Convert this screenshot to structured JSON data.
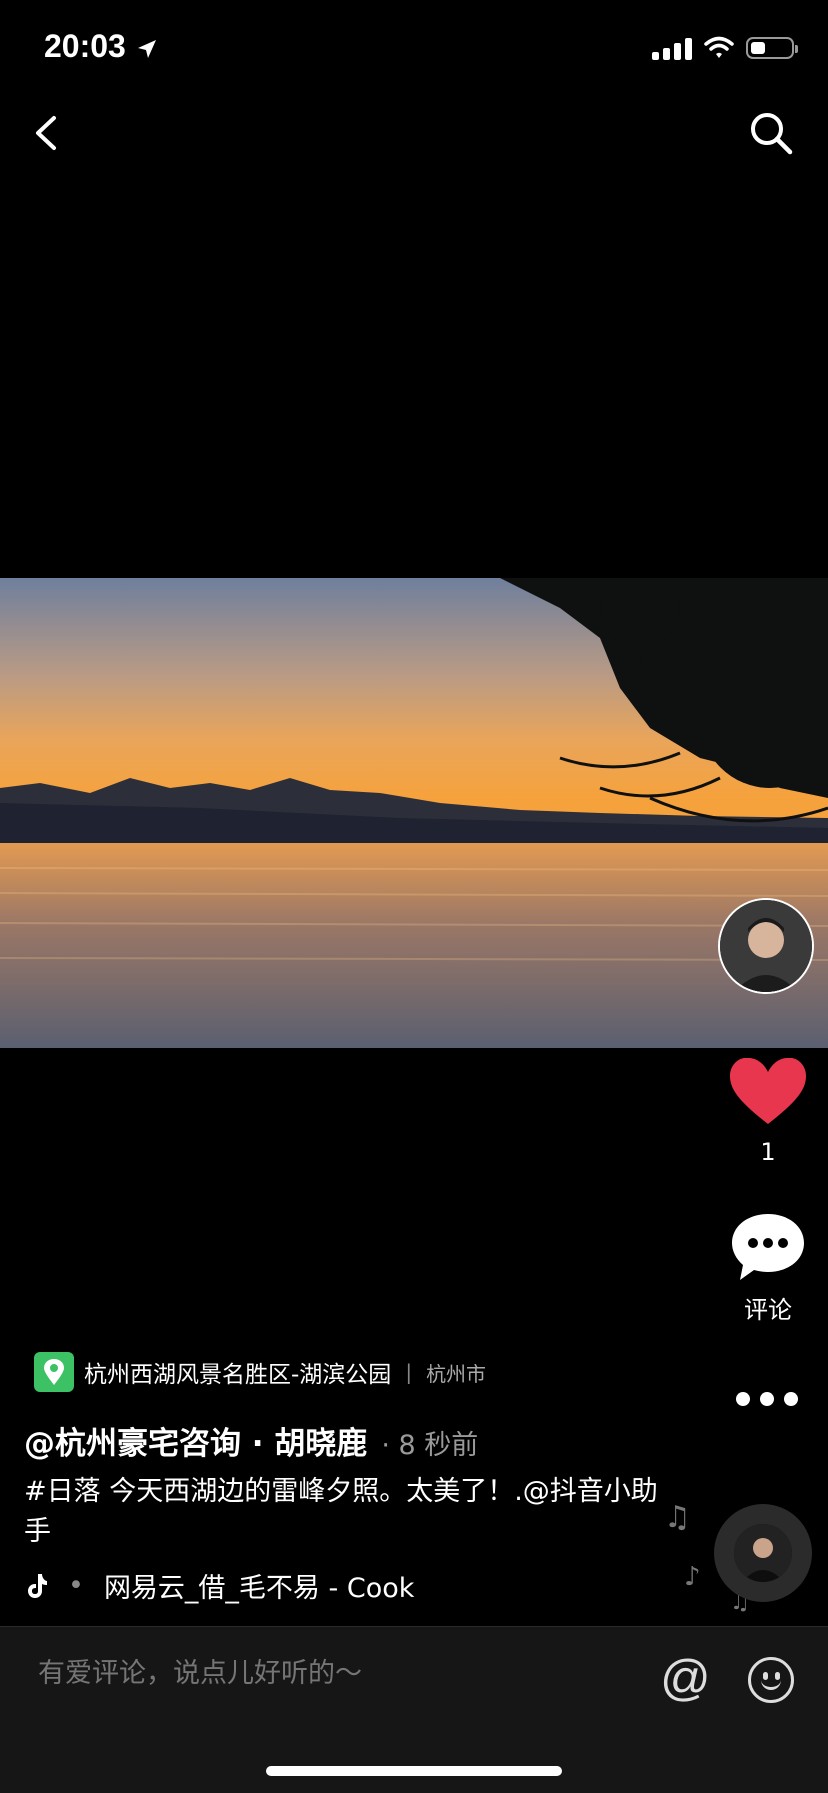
{
  "status_bar": {
    "time": "20:03"
  },
  "video": {
    "subject": "sunset over lake"
  },
  "sidebar": {
    "like_count": "1",
    "comment_label": "评论"
  },
  "location": {
    "name": "杭州西湖风景名胜区-湖滨公园",
    "separator": "|",
    "city": "杭州市"
  },
  "post": {
    "author": "@杭州豪宅咨询 · 胡晓鹿",
    "time_ago": "· 8 秒前",
    "description": "#日落  今天西湖边的雷峰夕照。太美了！.@抖音小助手",
    "music": "网易云_借_毛不易 - Cook",
    "music_dot": "•"
  },
  "comment_bar": {
    "placeholder": "有爱评论，说点儿好听的～",
    "at_symbol": "@"
  },
  "colors": {
    "like": "#e8364f",
    "location_pin": "#3cc264",
    "background": "#000000",
    "comment_bar": "#161616"
  }
}
